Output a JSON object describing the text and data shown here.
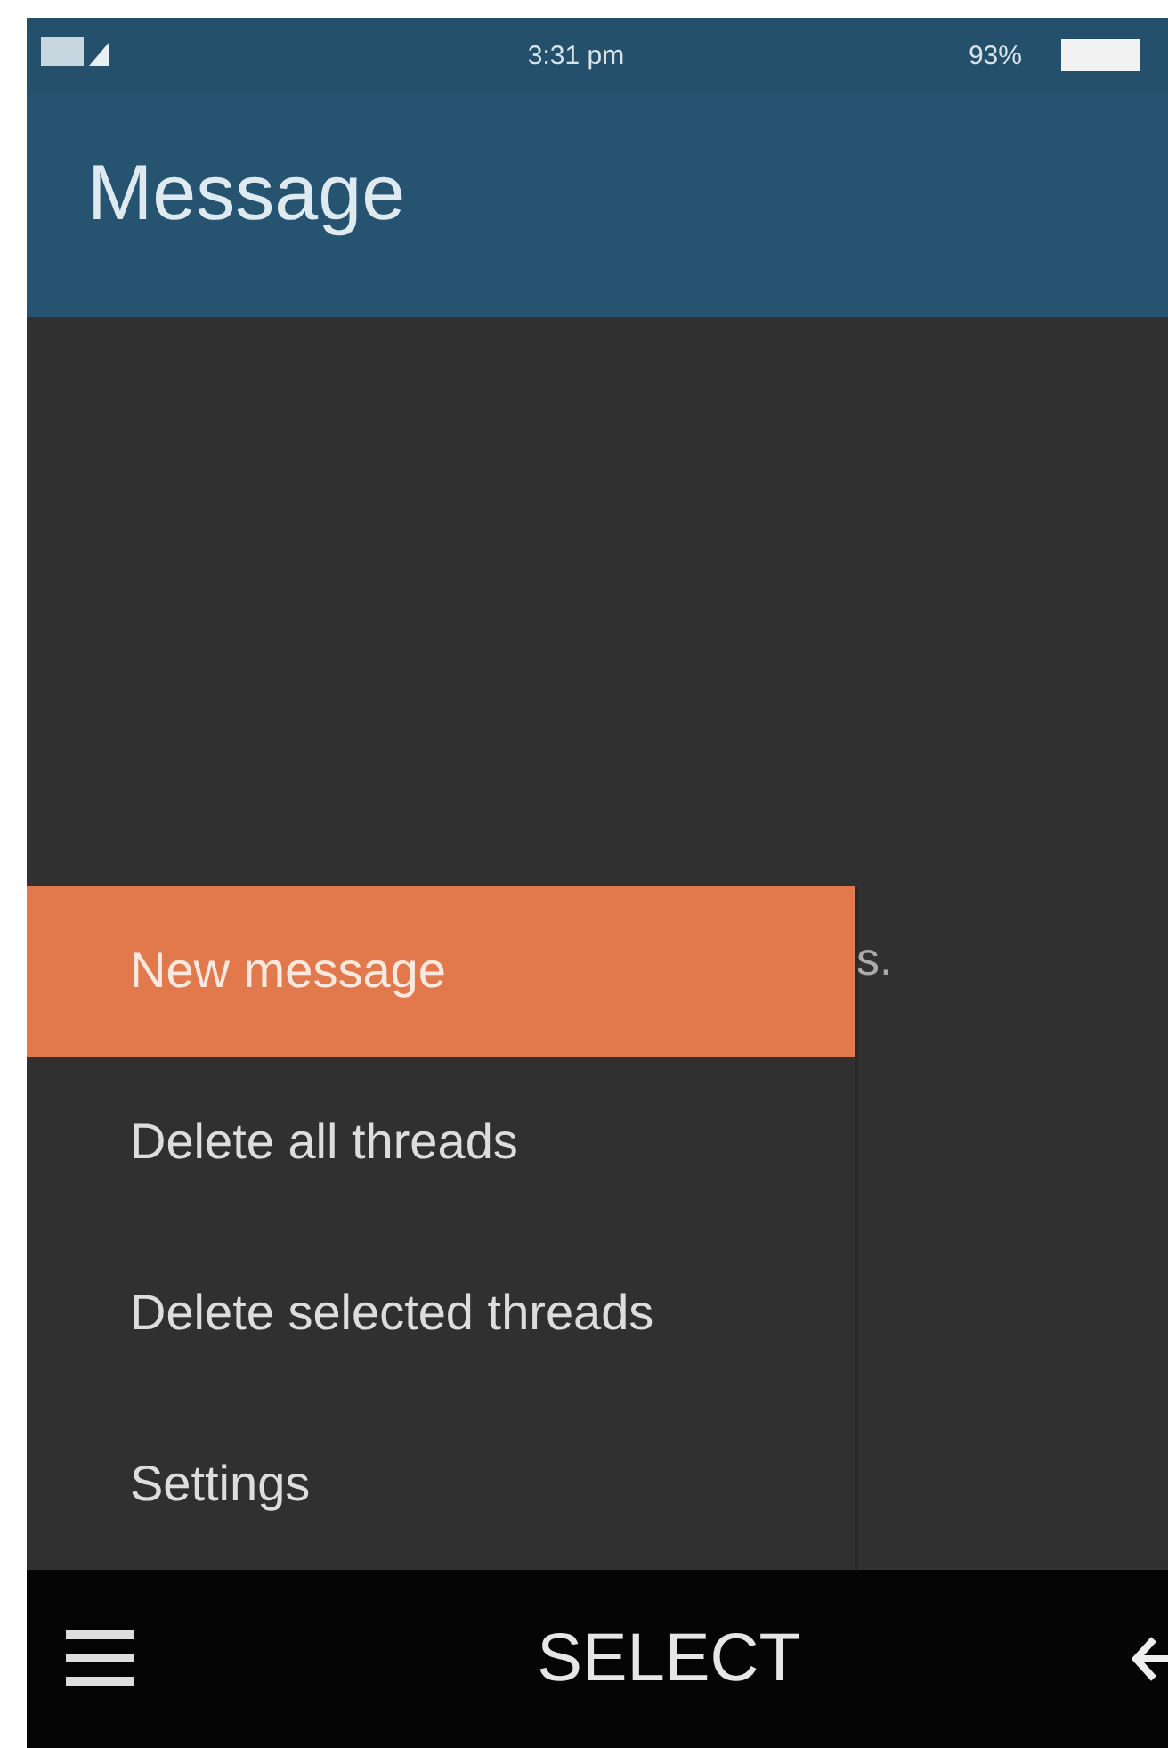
{
  "status_bar": {
    "time": "3:31 pm",
    "battery": "93%"
  },
  "header": {
    "title": "Message"
  },
  "body": {
    "partial_text": "s."
  },
  "menu": {
    "items": [
      {
        "label": "New message",
        "selected": true
      },
      {
        "label": "Delete all threads",
        "selected": false
      },
      {
        "label": "Delete selected threads",
        "selected": false
      },
      {
        "label": "Settings",
        "selected": false
      }
    ]
  },
  "softkeys": {
    "center": "SELECT"
  }
}
